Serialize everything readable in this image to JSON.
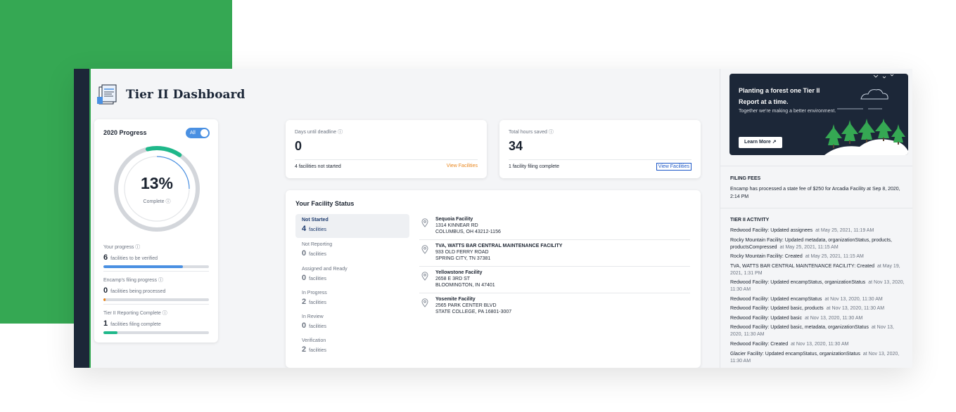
{
  "colors": {
    "brand_green": "#35a853",
    "navy": "#1c2738",
    "accent_blue": "#4a90e2",
    "link_orange": "#e8851c"
  },
  "header": {
    "title": "Tier II Dashboard",
    "icon": "document-stack-icon"
  },
  "progress": {
    "title": "2020 Progress",
    "toggle_label": "All",
    "percent": "13%",
    "percent_value": 13,
    "complete_label": "Complete",
    "items": [
      {
        "label": "Your progress",
        "count": "6",
        "text": "facilities to be verified",
        "fill": 0.75,
        "color": "#4a90e2"
      },
      {
        "label": "Encamp's filing progress",
        "count": "0",
        "text": "facilities being processed",
        "fill": 0.02,
        "color": "#e8851c"
      },
      {
        "label": "Tier II Reporting Complete",
        "count": "1",
        "text": "facilities filing complete",
        "fill": 0.13,
        "color": "#1fb88a"
      }
    ]
  },
  "stats": {
    "deadline": {
      "label": "Days until deadline",
      "value": "0",
      "footer": "4 facilities not started",
      "link": "View Facilities"
    },
    "hours": {
      "label": "Total hours saved",
      "value": "34",
      "footer": "1 facility filing complete",
      "link": "View Facilities"
    }
  },
  "facility_status": {
    "title": "Your Facility Status",
    "statuses": [
      {
        "name": "Not Started",
        "count": "4",
        "unit": "facilities"
      },
      {
        "name": "Not Reporting",
        "count": "0",
        "unit": "facilities"
      },
      {
        "name": "Assigned and Ready",
        "count": "0",
        "unit": "facilities"
      },
      {
        "name": "In Progress",
        "count": "2",
        "unit": "facilities"
      },
      {
        "name": "In Review",
        "count": "0",
        "unit": "facilities"
      },
      {
        "name": "Verification",
        "count": "2",
        "unit": "facilities"
      }
    ],
    "facilities": [
      {
        "name": "Sequoia Facility",
        "line1": "1314 KINNEAR RD",
        "line2": "COLUMBUS, OH 43212-1156"
      },
      {
        "name": "TVA, WATTS BAR CENTRAL MAINTENANCE FACILITY",
        "line1": "933 OLD FERRY ROAD",
        "line2": "SPRING CITY, TN 37381"
      },
      {
        "name": "Yellowstone Facility",
        "line1": "2658 E 3RD ST",
        "line2": "BLOOMINGTON, IN 47401"
      },
      {
        "name": "Yosemite Facility",
        "line1": "2565 PARK CENTER BLVD",
        "line2": "STATE COLLEGE, PA 16801-3007"
      }
    ]
  },
  "promo": {
    "title": "Planting a forest one Tier II Report at a time.",
    "subtitle": "Together we're making a better environment.",
    "button": "Learn More"
  },
  "filing_fees": {
    "heading": "FILING FEES",
    "text": "Encamp has processed a state fee of $250 for Arcadia Facility at Sep 8, 2020, 2:14 PM"
  },
  "activity": {
    "heading": "TIER II ACTIVITY",
    "items": [
      {
        "text": "Redwood Facility: Updated assignees",
        "time": "at May 25, 2021, 11:19 AM"
      },
      {
        "text": "Rocky Mountain Facility: Updated metadata, organizationStatus, products, productsCompressed",
        "time": "at May 25, 2021, 11:15 AM"
      },
      {
        "text": "Rocky Mountain Facility: Created",
        "time": "at May 25, 2021, 11:15 AM"
      },
      {
        "text": "TVA, WATTS BAR CENTRAL MAINTENANCE FACILITY: Created",
        "time": "at May 19, 2021, 1:31 PM"
      },
      {
        "text": "Redwood Facility: Updated encampStatus, organizationStatus",
        "time": "at Nov 13, 2020, 11:30 AM"
      },
      {
        "text": "Redwood Facility: Updated encampStatus",
        "time": "at Nov 13, 2020, 11:30 AM"
      },
      {
        "text": "Redwood Facility: Updated basic, products",
        "time": "at Nov 13, 2020, 11:30 AM"
      },
      {
        "text": "Redwood Facility: Updated basic",
        "time": "at Nov 13, 2020, 11:30 AM"
      },
      {
        "text": "Redwood Facility: Updated basic, metadata, organizationStatus",
        "time": "at Nov 13, 2020, 11:30 AM"
      },
      {
        "text": "Redwood Facility: Created",
        "time": "at Nov 13, 2020, 11:30 AM"
      },
      {
        "text": "Glacier Facility: Updated encampStatus, organizationStatus",
        "time": "at Nov 13, 2020, 11:30 AM"
      }
    ]
  }
}
